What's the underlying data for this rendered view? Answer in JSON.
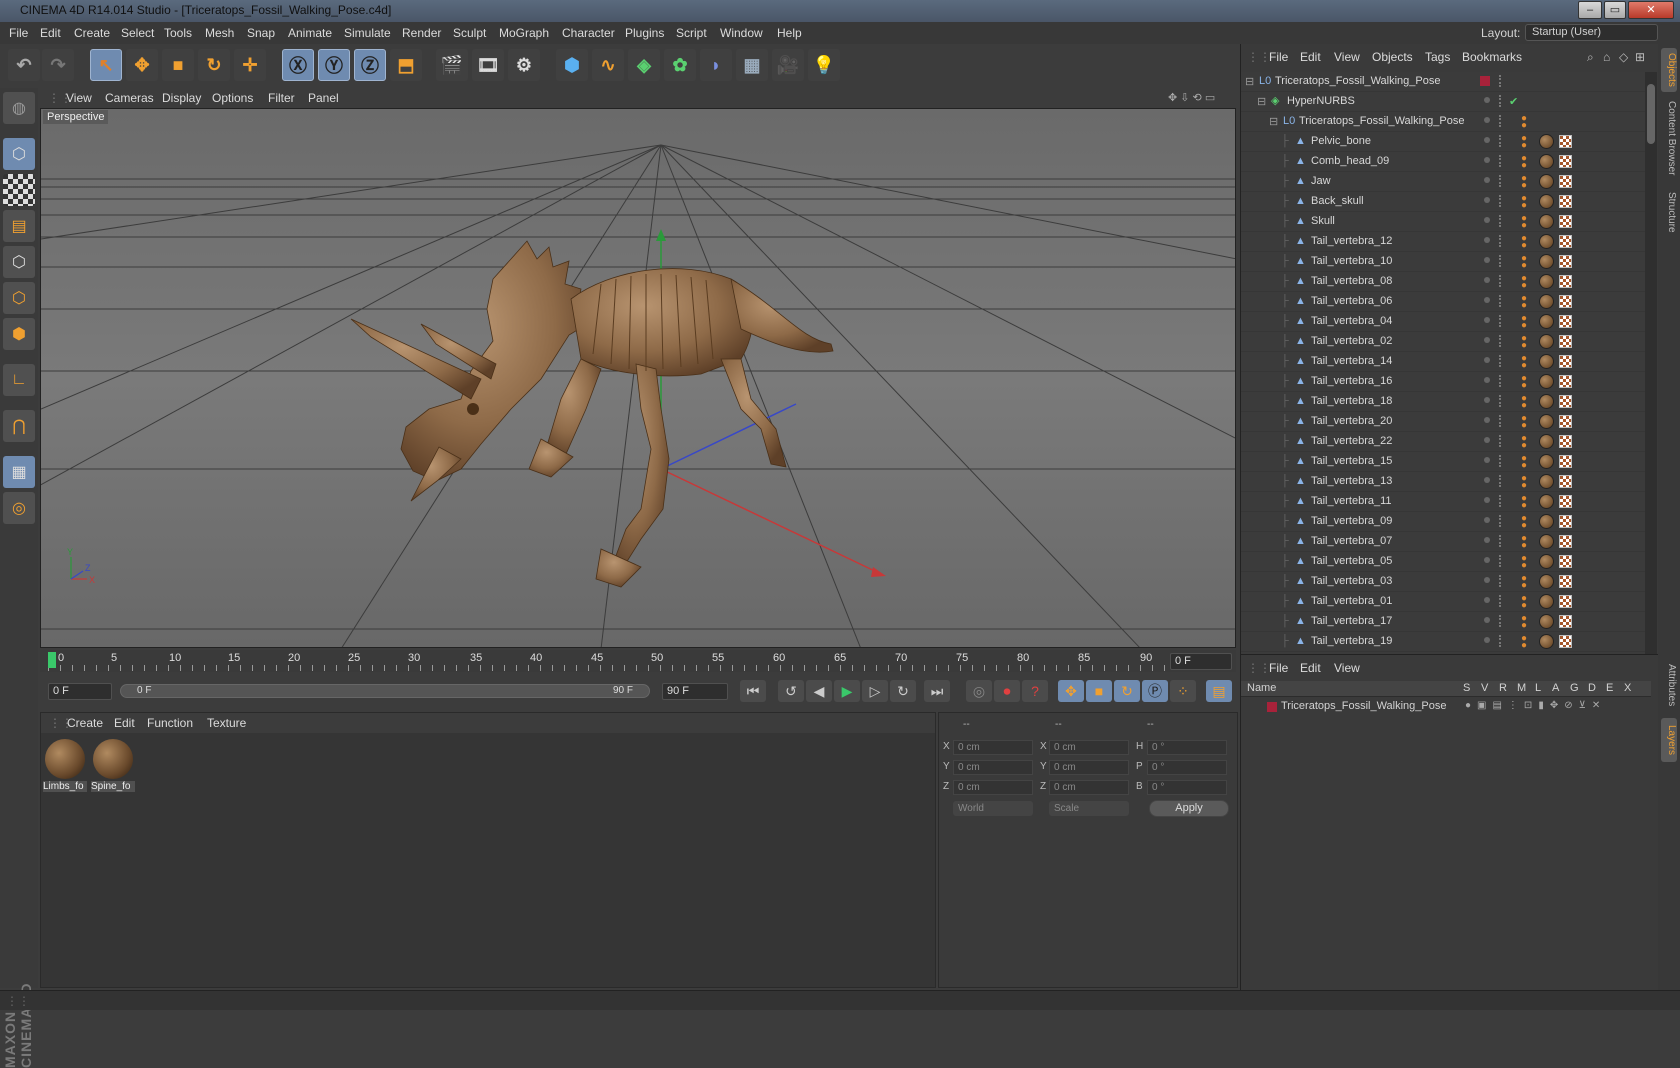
{
  "window": {
    "title": "CINEMA 4D R14.014 Studio - [Triceratops_Fossil_Walking_Pose.c4d]"
  },
  "menu": [
    "File",
    "Edit",
    "Create",
    "Select",
    "Tools",
    "Mesh",
    "Snap",
    "Animate",
    "Simulate",
    "Render",
    "Sculpt",
    "MoGraph",
    "Character",
    "Plugins",
    "Script",
    "Window",
    "Help"
  ],
  "layout": {
    "label": "Layout:",
    "value": "Startup (User)"
  },
  "viewport": {
    "menu": [
      "View",
      "Cameras",
      "Display",
      "Options",
      "Filter",
      "Panel"
    ],
    "camera_label": "Perspective"
  },
  "timeline": {
    "ticks": [
      "0",
      "5",
      "10",
      "15",
      "20",
      "25",
      "30",
      "35",
      "40",
      "45",
      "50",
      "55",
      "60",
      "65",
      "70",
      "75",
      "80",
      "85",
      "90"
    ],
    "current_frame": "0 F"
  },
  "transport": {
    "start": "0 F",
    "range_start": "0 F",
    "range_end": "90 F",
    "end": "90 F"
  },
  "material_manager": {
    "menu": [
      "Create",
      "Edit",
      "Function",
      "Texture"
    ],
    "materials": [
      "Limbs_fo",
      "Spine_fo"
    ]
  },
  "coordinates": {
    "headers": [
      "--",
      "--",
      "--"
    ],
    "rows": [
      {
        "a": "X",
        "av": "0 cm",
        "b": "X",
        "bv": "0 cm",
        "c": "H",
        "cv": "0 °"
      },
      {
        "a": "Y",
        "av": "0 cm",
        "b": "Y",
        "bv": "0 cm",
        "c": "P",
        "cv": "0 °"
      },
      {
        "a": "Z",
        "av": "0 cm",
        "b": "Z",
        "bv": "0 cm",
        "c": "B",
        "cv": "0 °"
      }
    ],
    "world": "World",
    "scale": "Scale",
    "apply": "Apply"
  },
  "object_manager": {
    "menu": [
      "File",
      "Edit",
      "View",
      "Objects",
      "Tags",
      "Bookmarks"
    ],
    "root": "Triceratops_Fossil_Walking_Pose",
    "hypernurbs": "HyperNURBS",
    "group": "Triceratops_Fossil_Walking_Pose",
    "objects": [
      "Pelvic_bone",
      "Comb_head_09",
      "Jaw",
      "Back_skull",
      "Skull",
      "Tail_vertebra_12",
      "Tail_vertebra_10",
      "Tail_vertebra_08",
      "Tail_vertebra_06",
      "Tail_vertebra_04",
      "Tail_vertebra_02",
      "Tail_vertebra_14",
      "Tail_vertebra_16",
      "Tail_vertebra_18",
      "Tail_vertebra_20",
      "Tail_vertebra_22",
      "Tail_vertebra_15",
      "Tail_vertebra_13",
      "Tail_vertebra_11",
      "Tail_vertebra_09",
      "Tail_vertebra_07",
      "Tail_vertebra_05",
      "Tail_vertebra_03",
      "Tail_vertebra_01",
      "Tail_vertebra_17",
      "Tail_vertebra_19"
    ]
  },
  "layer_manager": {
    "menu": [
      "File",
      "Edit",
      "View"
    ],
    "columns": [
      "Name",
      "S",
      "V",
      "R",
      "M",
      "L",
      "A",
      "G",
      "D",
      "E",
      "X"
    ],
    "layer": "Triceratops_Fossil_Walking_Pose"
  },
  "right_tabs": [
    "Objects",
    "Content Browser",
    "Structure",
    "Attributes",
    "Layers"
  ],
  "branding": "MAXON CINEMA 4D",
  "colors": {
    "accent": "#6f8bb0",
    "layer": "#a8223a",
    "tag": "#e08a30"
  }
}
